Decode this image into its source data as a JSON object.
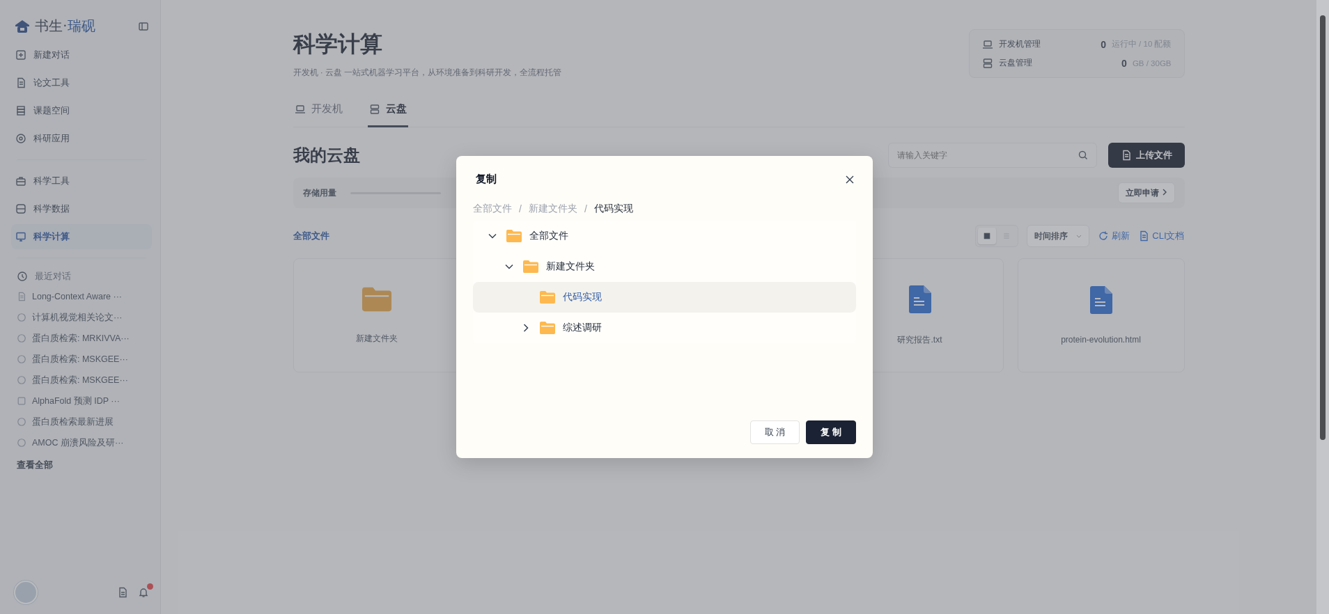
{
  "sidebar": {
    "brand": {
      "name": "书生·",
      "accent": "瑞砚"
    },
    "nav_groups": [
      [
        {
          "label": "新建对话",
          "kind": "plus",
          "selected": false
        },
        {
          "label": "论文工具",
          "kind": "doc",
          "selected": false
        },
        {
          "label": "课题空间",
          "kind": "stack",
          "selected": false
        },
        {
          "label": "科研应用",
          "kind": "gear",
          "selected": false
        }
      ],
      [
        {
          "label": "科学工具",
          "kind": "tool",
          "selected": false
        },
        {
          "label": "科学数据",
          "kind": "db",
          "selected": false
        },
        {
          "label": "科学计算",
          "kind": "monitor",
          "selected": true
        }
      ]
    ],
    "recent": {
      "title": "最近对话",
      "items": [
        {
          "label": "Long-Context Aware ···",
          "kind": "doc"
        },
        {
          "label": "计算机视觉相关论文···",
          "kind": "chat"
        },
        {
          "label": "蛋白质检索: MRKIVVA···",
          "kind": "chat"
        },
        {
          "label": "蛋白质检索: MSKGEE···",
          "kind": "chat"
        },
        {
          "label": "蛋白质检索: MSKGEE···",
          "kind": "chat"
        },
        {
          "label": "AlphaFold 预测 IDP ···",
          "kind": "box"
        },
        {
          "label": "蛋白质检索最新进展",
          "kind": "chat"
        },
        {
          "label": "AMOC 崩溃风险及研···",
          "kind": "chat"
        }
      ]
    },
    "view_all": "查看全部",
    "unread": true
  },
  "main": {
    "title": "科学计算",
    "subtitle": "开发机 · 云盘 一站式机器学习平台，从环境准备到科研开发，全流程托管",
    "stats": [
      {
        "kind": "machine",
        "label": "开发机管理",
        "value": "0",
        "unit": "运行中 / 10 配额"
      },
      {
        "kind": "disk",
        "label": "云盘管理",
        "value": "0",
        "unit": "GB / 30GB"
      }
    ],
    "tabs": [
      {
        "kind": "machine",
        "label": "开发机",
        "selected": false
      },
      {
        "kind": "disk",
        "label": "云盘",
        "selected": true
      }
    ]
  },
  "drive": {
    "title": "我的云盘",
    "search": {
      "placeholder": "请输入关键字"
    },
    "upload_button": "上传文件",
    "storage": {
      "label": "存储用量"
    },
    "apply_button": "立即申请",
    "section": "全部文件",
    "views": [
      {
        "kind": "grid",
        "selected": true
      },
      {
        "kind": "list",
        "selected": false
      }
    ],
    "sort": "时间排序",
    "actions": [
      {
        "kind": "refresh",
        "label": "刷新"
      },
      {
        "kind": "doc",
        "label": "CLI文档"
      }
    ],
    "cards": [
      {
        "kind": "folder",
        "name": "新建文件夹"
      },
      {
        "kind": "file",
        "name": "研究报告.txt"
      },
      {
        "kind": "file",
        "name": "protein-evolution.html"
      }
    ]
  },
  "dialog": {
    "title": "复制",
    "breadcrumb": [
      {
        "kind": "item",
        "label": "全部文件"
      },
      {
        "kind": "separator",
        "label": "/"
      },
      {
        "kind": "item",
        "label": "新建文件夹"
      },
      {
        "kind": "separator",
        "label": "/"
      },
      {
        "kind": "item",
        "label": "代码实现"
      }
    ],
    "tree": [
      {
        "label": "全部文件",
        "has_children": true,
        "expanded": true,
        "selected": false,
        "children": [
          {
            "label": "新建文件夹",
            "has_children": true,
            "expanded": true,
            "selected": false,
            "children": [
              {
                "label": "代码实现",
                "has_children": false,
                "expanded": false,
                "selected": true
              },
              {
                "label": "综述调研",
                "has_children": true,
                "expanded": false,
                "selected": false
              }
            ]
          }
        ]
      }
    ],
    "cancel_button": "取 消",
    "confirm_button": "复 制"
  }
}
